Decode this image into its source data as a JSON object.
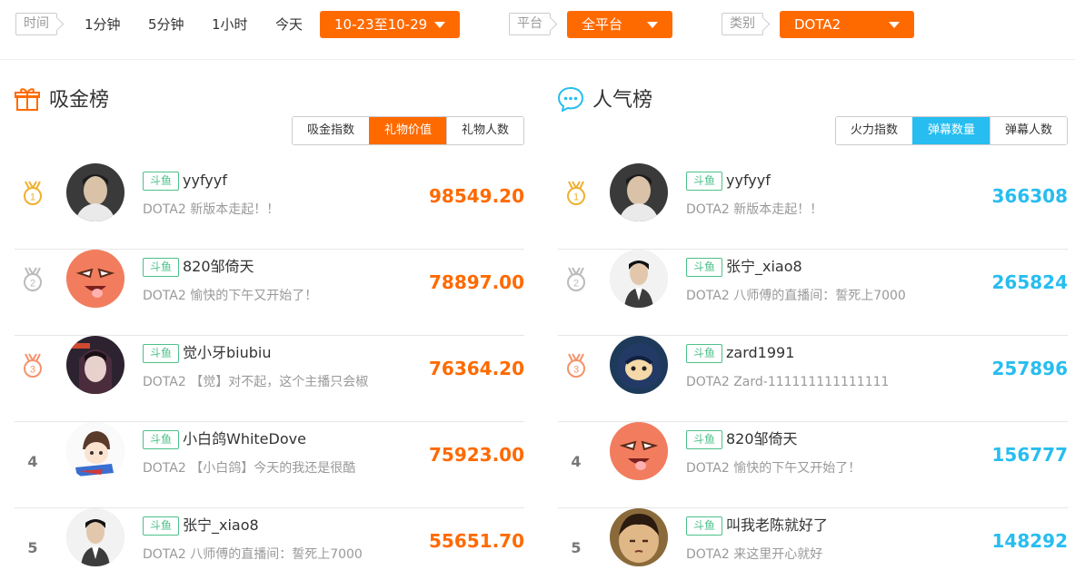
{
  "filters": {
    "time_label": "时间",
    "time_options": [
      "1分钟",
      "5分钟",
      "1小时",
      "今天"
    ],
    "date_range": "10-23至10-29",
    "platform_label": "平台",
    "platform_value": "全平台",
    "category_label": "类别",
    "category_value": "DOTA2"
  },
  "colors": {
    "accent_orange": "#ff6a00",
    "accent_blue": "#27bdf0",
    "platform_badge": "#4cc18a"
  },
  "gold_board": {
    "title": "吸金榜",
    "icon": "gift-icon",
    "tabs": [
      "吸金指数",
      "礼物价值",
      "礼物人数"
    ],
    "active_tab": 1,
    "rows": [
      {
        "rank": "1",
        "platform": "斗鱼",
        "name": "yyfyyf",
        "desc": "DOTA2 新版本走起！！",
        "score": "98549.20"
      },
      {
        "rank": "2",
        "platform": "斗鱼",
        "name": "820邹倚天",
        "desc": "DOTA2 愉快的下午又开始了！",
        "score": "78897.00"
      },
      {
        "rank": "3",
        "platform": "斗鱼",
        "name": "觉小牙biubiu",
        "desc": "DOTA2 【觉】对不起，这个主播只会椒",
        "score": "76364.20"
      },
      {
        "rank": "4",
        "platform": "斗鱼",
        "name": "小白鸽WhiteDove",
        "desc": "DOTA2 【小白鸽】今天的我还是很酷",
        "score": "75923.00"
      },
      {
        "rank": "5",
        "platform": "斗鱼",
        "name": "张宁_xiao8",
        "desc": "DOTA2 八师傅的直播间：誓死上7000",
        "score": "55651.70"
      }
    ]
  },
  "popularity_board": {
    "title": "人气榜",
    "icon": "chat-bubble-icon",
    "tabs": [
      "火力指数",
      "弹幕数量",
      "弹幕人数"
    ],
    "active_tab": 1,
    "rows": [
      {
        "rank": "1",
        "platform": "斗鱼",
        "name": "yyfyyf",
        "desc": "DOTA2 新版本走起！！",
        "score": "366308"
      },
      {
        "rank": "2",
        "platform": "斗鱼",
        "name": "张宁_xiao8",
        "desc": "DOTA2 八师傅的直播间：誓死上7000",
        "score": "265824"
      },
      {
        "rank": "3",
        "platform": "斗鱼",
        "name": "zard1991",
        "desc": "DOTA2 Zard-111111111111111",
        "score": "257896"
      },
      {
        "rank": "4",
        "platform": "斗鱼",
        "name": "820邹倚天",
        "desc": "DOTA2 愉快的下午又开始了！",
        "score": "156777"
      },
      {
        "rank": "5",
        "platform": "斗鱼",
        "name": "叫我老陈就好了",
        "desc": "DOTA2 来这里开心就好",
        "score": "148292"
      }
    ]
  }
}
